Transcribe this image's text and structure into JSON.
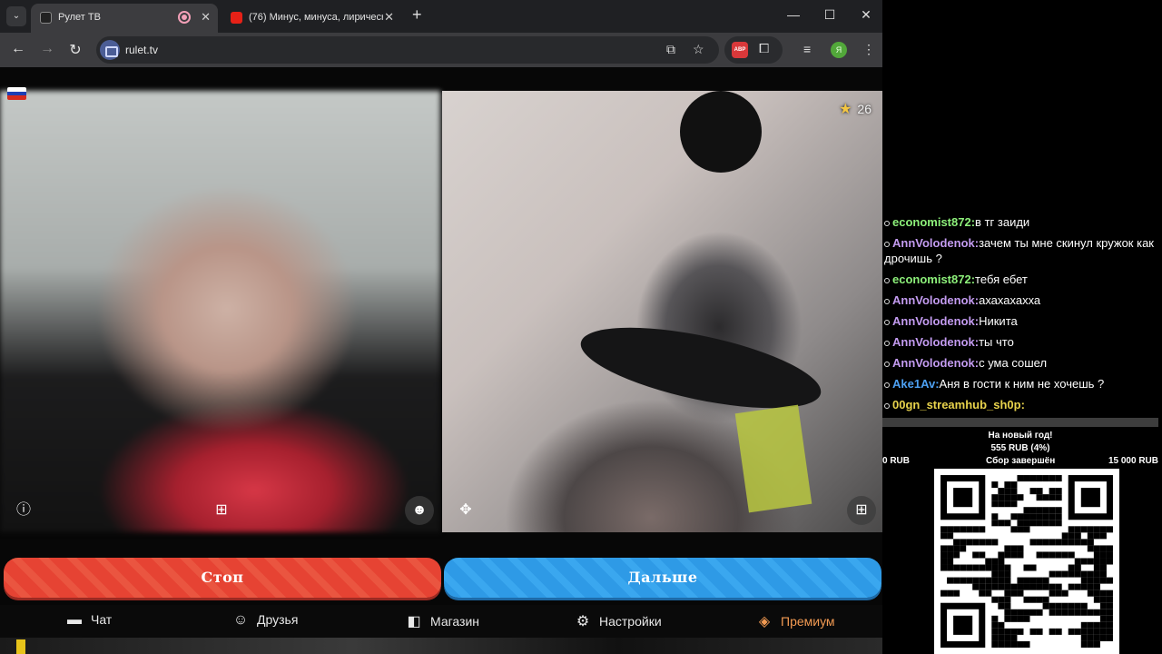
{
  "browser": {
    "tabs": [
      {
        "title": "Рулет ТВ",
        "active": true
      },
      {
        "title": "(76) Минус, минуса, лирическ",
        "active": false
      }
    ],
    "url": "rulet.tv",
    "profile_initial": "Я"
  },
  "video": {
    "right_star_count": "26",
    "flag": "russia"
  },
  "buttons": {
    "stop_label": "Стоп",
    "next_label": "Дальше"
  },
  "nav": {
    "items": [
      {
        "label": "Чат",
        "icon": "chat-icon"
      },
      {
        "label": "Друзья",
        "icon": "friends-icon"
      },
      {
        "label": "Магазин",
        "icon": "shop-icon"
      },
      {
        "label": "Настройки",
        "icon": "settings-icon"
      },
      {
        "label": "Премиум",
        "icon": "premium-tag-icon"
      }
    ]
  },
  "chat": {
    "messages": [
      {
        "user": "economist872:",
        "text": "в тг заиди",
        "color": "#8df07a"
      },
      {
        "user": "AnnVolodenok:",
        "text": "зачем ты мне скинул кружок как дрочишь ?",
        "color": "#c39bf0"
      },
      {
        "user": "economist872:",
        "text": "тебя ебет",
        "color": "#8df07a"
      },
      {
        "user": "AnnVolodenok:",
        "text": "ахахахахха",
        "color": "#c39bf0"
      },
      {
        "user": "AnnVolodenok:",
        "text": "Никита",
        "color": "#c39bf0"
      },
      {
        "user": "AnnVolodenok:",
        "text": "ты что",
        "color": "#c39bf0"
      },
      {
        "user": "AnnVolodenok:",
        "text": "с ума сошел",
        "color": "#c39bf0"
      },
      {
        "user": "Ake1Av:",
        "text": "Аня в гости к ним не хочешь ?",
        "color": "#4da0f2"
      },
      {
        "user": "00gn_streamhub_sh0p:",
        "text": "",
        "color": "#e8d34c"
      }
    ]
  },
  "donation_goal": {
    "title": "На новый год!",
    "amount": "555 RUB (4%)",
    "min": "0 RUB",
    "status": "Сбор завершён",
    "max": "15 000 RUB"
  },
  "colors": {
    "stop_button": "#e64333",
    "next_button": "#2e9ae6",
    "premium": "#f29a52"
  }
}
